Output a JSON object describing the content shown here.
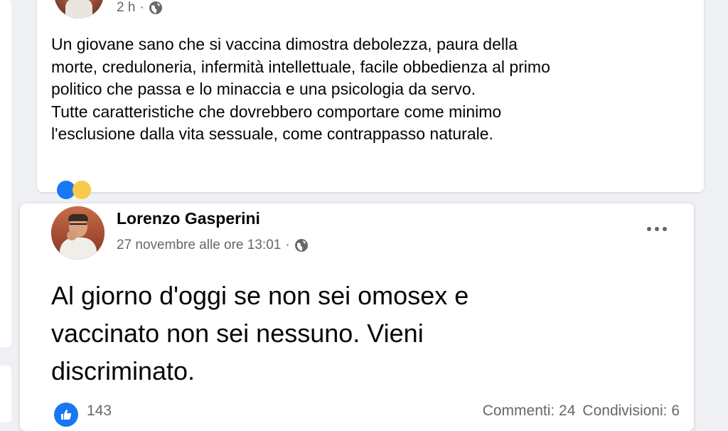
{
  "post1": {
    "time": "2 h",
    "separator": "·",
    "privacy_icon": "globe-icon",
    "lines": [
      "Un giovane sano che si vaccina dimostra debolezza, paura della",
      "morte, creduloneria, infermità intellettuale, facile obbedienza al primo",
      "politico che passa e lo minaccia e una psicologia da servo.",
      "Tutte caratteristiche che dovrebbero comportare come minimo",
      "l'esclusione dalla vita sessuale, come contrappasso naturale."
    ]
  },
  "post2": {
    "author": "Lorenzo Gasperini",
    "timestamp": "27 novembre alle ore 13:01",
    "separator": "·",
    "privacy_icon": "globe-icon",
    "more_icon": "more-options-icon",
    "text_lines": [
      "Al giorno d'oggi se non sei omosex e",
      "vaccinato non sei nessuno. Vieni",
      "discriminato."
    ],
    "reaction_icon": "like-icon",
    "reaction_count": "143",
    "comments": "Commenti: 24",
    "shares": "Condivisioni: 6"
  },
  "colors": {
    "background": "#eef0f3",
    "card": "#ffffff",
    "text": "#050505",
    "secondary_text": "#65676b",
    "like_blue": "#1877f2"
  }
}
